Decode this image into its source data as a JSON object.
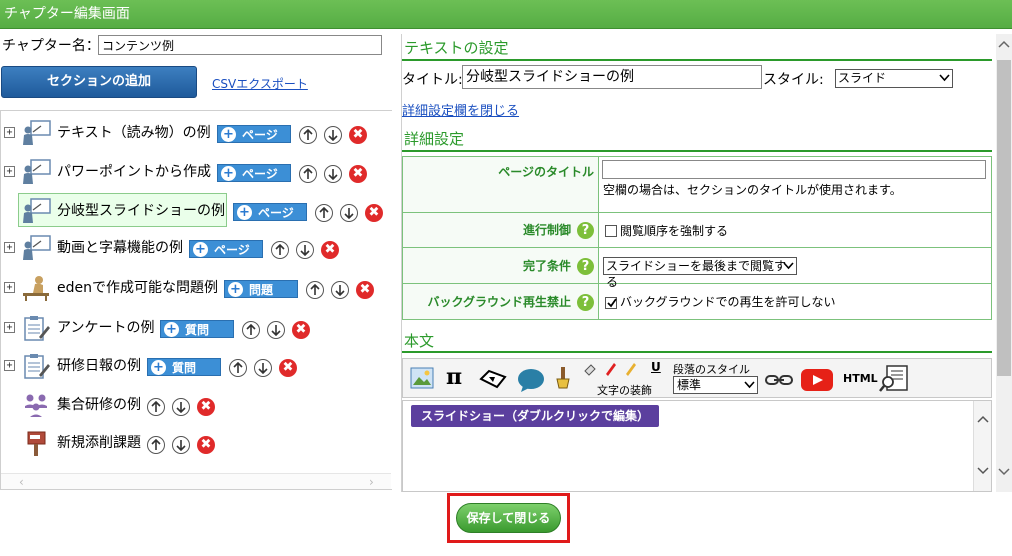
{
  "window": {
    "title": "チャプター編集画面"
  },
  "left": {
    "chapter_label": "チャプター名：",
    "chapter_value": "コンテンツ例",
    "add_section_label": "セクションの追加",
    "csv_export_label": "CSVエクスポート",
    "items": [
      {
        "label": "テキスト（読み物）の例",
        "tag": "ページ",
        "icon": "lecture-icon"
      },
      {
        "label": "パワーポイントから作成",
        "tag": "ページ",
        "icon": "lecture-icon"
      },
      {
        "label": "分岐型スライドショーの例",
        "tag": "ページ",
        "icon": "lecture-icon"
      },
      {
        "label": "動画と字幕機能の例",
        "tag": "ページ",
        "icon": "lecture-icon"
      },
      {
        "label": "edenで作成可能な問題例",
        "tag": "問題",
        "icon": "student-desk-icon"
      },
      {
        "label": "アンケートの例",
        "tag": "質問",
        "icon": "clipboard-icon"
      },
      {
        "label": "研修日報の例",
        "tag": "質問",
        "icon": "clipboard-icon"
      },
      {
        "label": "集合研修の例",
        "tag": "",
        "icon": "group-icon"
      },
      {
        "label": "新規添削課題",
        "tag": "",
        "icon": "postbox-icon"
      }
    ]
  },
  "right": {
    "text_settings_title": "テキストの設定",
    "title_label": "タイトル:",
    "title_value": "分岐型スライドショーの例",
    "style_label": "スタイル:",
    "style_value": "スライド",
    "close_detail_link": "詳細設定欄を閉じる",
    "detail_title": "詳細設定",
    "rows": {
      "page_title_label": "ページのタイトル",
      "page_title_hint": "空欄の場合は、セクションのタイトルが使用されます。",
      "progress_label": "進行制御",
      "progress_option": "閲覧順序を強制する",
      "complete_label": "完了条件",
      "complete_value": "スライドショーを最後まで閲覧する",
      "bg_label": "バックグラウンド再生禁止",
      "bg_option": "バックグラウンドでの再生を許可しない"
    },
    "body_title": "本文",
    "toolbar": {
      "text_decor_label": "文字の装飾",
      "paragraph_style_label": "段落のスタイル",
      "paragraph_style_value": "標準",
      "html_label": "HTML",
      "pi_label": "π"
    },
    "editor_chip": "スライドショー（ダブルクリックで編集）"
  },
  "footer": {
    "save_close_label": "保存して閉じる"
  }
}
